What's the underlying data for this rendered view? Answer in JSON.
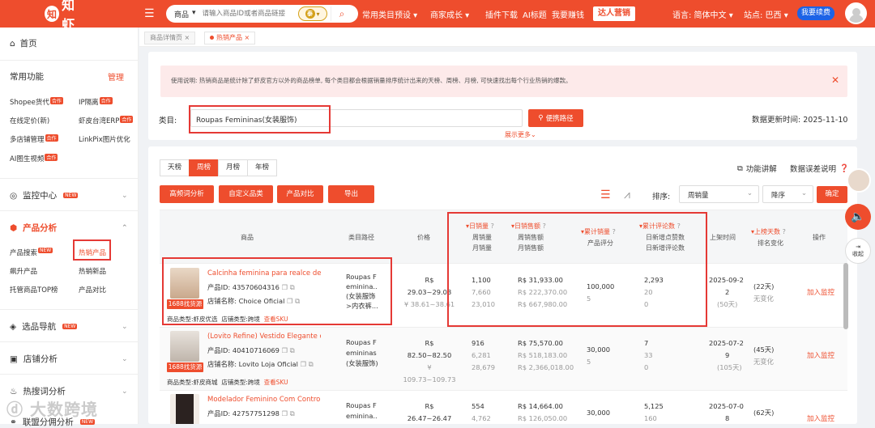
{
  "topbar": {
    "logo_mark": "知",
    "logo_text": "知虾",
    "search_category": "商品",
    "search_placeholder": "请输入商品ID或者商品链接",
    "lang_badge": "泰",
    "nav": [
      "常用类目预设",
      "商家成长",
      "插件下载",
      "AI标题",
      "我要赚钱"
    ],
    "nav_pill": "达人营销",
    "language": "语言: 简体中文",
    "site": "站点: 巴西",
    "renew": "我要续费"
  },
  "sidebar": {
    "home": "首页",
    "common_title": "常用功能",
    "manage": "管理",
    "common_links": [
      {
        "label": "Shopee货代",
        "tag": "合作"
      },
      {
        "label": "IP隔离",
        "tag": "合作"
      },
      {
        "label": "在线定价(新)",
        "tag": ""
      },
      {
        "label": "虾皮台湾ERP",
        "tag": "合作"
      },
      {
        "label": "多店铺管理",
        "tag": "合作"
      },
      {
        "label": "LinkPix图片优化",
        "tag": ""
      },
      {
        "label": "AI图生视频",
        "tag": "合作"
      }
    ],
    "groups": {
      "monitor": "监控中心",
      "product": "产品分析",
      "selection": "选品导航",
      "shop": "店铺分析",
      "hotword": "热搜词分析",
      "alliance": "联盟分佣分析"
    },
    "new_tag": "NEW",
    "product_links": [
      "产品搜索",
      "热销产品",
      "飙升产品",
      "热销新品",
      "托管商品TOP榜",
      "产品对比"
    ]
  },
  "page_tabs": [
    "商品详情页",
    "热销产品"
  ],
  "notice": "使用说明: 热销商品是统计除了虾皮官方以外的商品榜单, 每个类目都会根据销量排序统计出来的天榜、周榜、月榜, 可快速找出每个行业热销的爆款。",
  "category": {
    "label": "类目:",
    "value": "Roupas Femininas(女装服饰)",
    "route_button": "便携路径",
    "more": "展示更多",
    "update_label": "数据更新时间:",
    "update_date": "2025-11-10"
  },
  "rank_tabs": [
    "天榜",
    "周榜",
    "月榜",
    "年榜"
  ],
  "active_rank_tab": "周榜",
  "tools": {
    "guide": "功能讲解",
    "feedback": "数据误差说明"
  },
  "actions": [
    "高频词分析",
    "自定义品类",
    "产品对比",
    "导出"
  ],
  "sort": {
    "label": "排序:",
    "by": "周销量",
    "order": "降序",
    "confirm": "确定"
  },
  "table_headers": {
    "product": "商品",
    "category_path": "类目路径",
    "price": "价格",
    "sales": [
      "日销量",
      "周销量",
      "月销量"
    ],
    "revenue": [
      "日销售额",
      "周销售额",
      "月销售额"
    ],
    "cumulative": [
      "累计销量",
      "产品评分"
    ],
    "reviews": [
      "累计评论数",
      "日新增点赞数",
      "日新增评论数"
    ],
    "listed": "上架时间",
    "days": [
      "上榜天数",
      "排名变化"
    ],
    "operation": "操作"
  },
  "labels": {
    "product_id": "产品ID:",
    "shop_name": "店铺名称:",
    "product_type": "商品类型:",
    "shop_type": "店铺类型:",
    "view_sku": "查看SKU",
    "source_tag": "1688找货源",
    "add_monitor": "加入监控"
  },
  "rows": [
    {
      "title": "Calcinha feminina para realce de b...",
      "id": "43570604316",
      "shop": "Choice Oficial",
      "ptype": "虾皮优选",
      "stype": "跨境",
      "category": [
        "Roupas F",
        "eminina..",
        "(女装服饰",
        ">内衣裤..."
      ],
      "price": [
        "R$",
        "29.03~29.03",
        "¥ 38.61~38.61"
      ],
      "sales": [
        "1,100",
        "7,660",
        "23,010"
      ],
      "revenue": [
        "R$ 31,933.00",
        "R$ 222,370.00",
        "R$ 667,980.00"
      ],
      "cum": [
        "100,000",
        "5"
      ],
      "reviews": [
        "2,293",
        "20",
        "0"
      ],
      "listed": [
        "2025-09-2",
        "2"
      ],
      "days": [
        "(22天)",
        "无变化"
      ],
      "img_colors": [
        "#e9d8c6",
        "#c9a88c"
      ]
    },
    {
      "title": "(Lovito Refine) Vestido Elegante co...",
      "id": "40410716069",
      "shop": "Lovito Loja Oficial",
      "ptype": "虾皮商城",
      "stype": "跨境",
      "category": [
        "Roupas F",
        "emininas",
        "(女装服饰)"
      ],
      "price": [
        "R$",
        "82.50~82.50",
        "¥ 109.73~109.73"
      ],
      "sales": [
        "916",
        "6,281",
        "28,679"
      ],
      "revenue": [
        "R$ 75,570.00",
        "R$ 518,183.00",
        "R$ 2,366,018.00"
      ],
      "cum": [
        "30,000",
        "5"
      ],
      "reviews": [
        "7",
        "33",
        "0"
      ],
      "listed": [
        "2025-07-2",
        "9",
        "(105天)"
      ],
      "days": [
        "(45天)",
        "无变化"
      ],
      "img_colors": [
        "#e8e2dc",
        "#bfb5ab"
      ]
    },
    {
      "title": "Modelador Feminino Com Controle...",
      "id": "42757751298",
      "shop": "",
      "ptype": "",
      "stype": "",
      "category": [
        "Roupas F",
        "eminina.."
      ],
      "price": [
        "R$",
        "26.47~26.47"
      ],
      "sales": [
        "554",
        "4,762"
      ],
      "revenue": [
        "R$ 14,664.00",
        "R$ 126,050.00"
      ],
      "cum": [
        "30,000"
      ],
      "reviews": [
        "5,125",
        "160"
      ],
      "listed": [
        "2025-07-0",
        "8"
      ],
      "days": [
        "(62天)"
      ],
      "img_colors": [
        "#f2ece6",
        "#2b2220"
      ]
    }
  ],
  "row1_extras": {
    "listed_days": "(50天)"
  },
  "float": {
    "fold": "收起"
  },
  "watermark": "大数跨境",
  "colors": {
    "brand": "#ee4d2d",
    "highlight_box": "#e53935",
    "renew": "#1d63e6"
  }
}
